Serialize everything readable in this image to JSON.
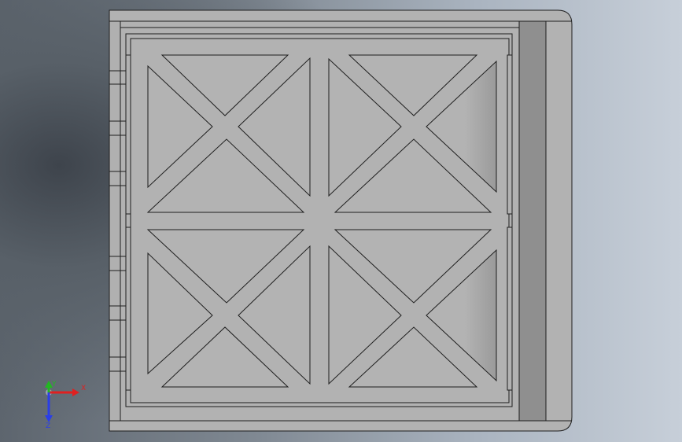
{
  "viewport": {
    "background_dark": "#3e444c",
    "background_light": "#c7cfd9"
  },
  "model": {
    "body_color": "#b2b2b2",
    "edge_color": "#1e1e1e",
    "side_strip_color": "#8f8f8f"
  },
  "triad": {
    "x_label": "X",
    "y_label": "Y",
    "z_label": "Z",
    "x_color": "#e02020",
    "y_color": "#22b822",
    "z_color": "#2a3ee8"
  }
}
